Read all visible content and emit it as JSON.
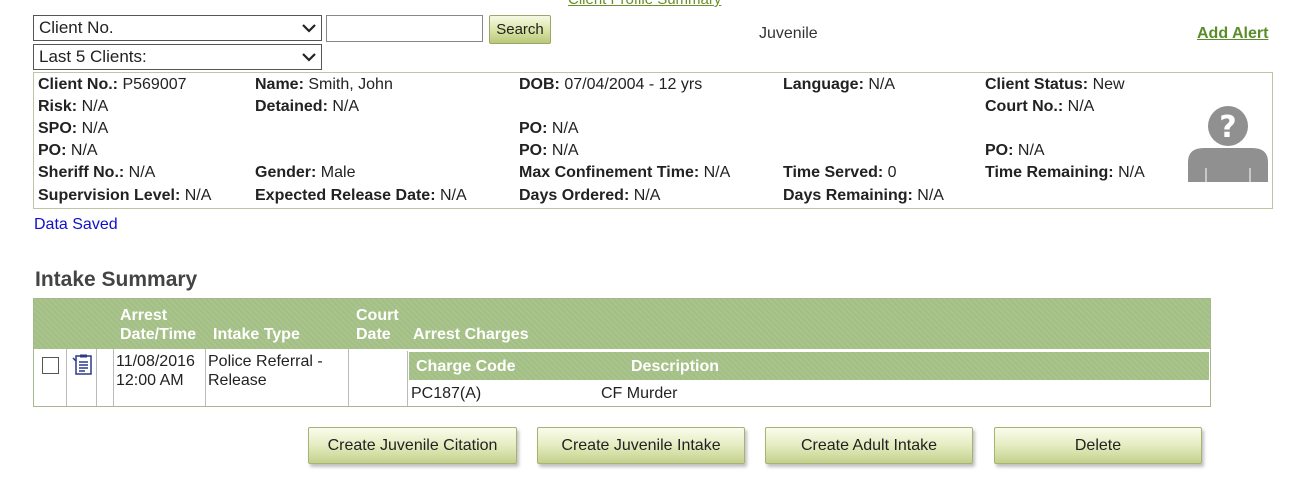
{
  "header": {
    "top_link": "Client Profile Summary",
    "client_select": "Client No.",
    "recent_select": "Last 5 Clients:",
    "search_value": "",
    "search_button": "Search",
    "client_type": "Juvenile",
    "add_alert": "Add Alert"
  },
  "client": {
    "client_no_label": "Client No.:",
    "client_no": "P569007",
    "name_label": "Name:",
    "name": "Smith, John",
    "dob_label": "DOB:",
    "dob": "07/04/2004 - 12 yrs",
    "language_label": "Language:",
    "language": "N/A",
    "status_label": "Client Status:",
    "status": "New",
    "risk_label": "Risk:",
    "risk": "N/A",
    "detained_label": "Detained:",
    "detained": "N/A",
    "court_no_label": "Court No.:",
    "court_no": "N/A",
    "spo_label": "SPO:",
    "spo": "N/A",
    "po1_label": "PO:",
    "po1": "N/A",
    "po2_label": "PO:",
    "po2": "N/A",
    "po3_label": "PO:",
    "po3": "N/A",
    "po4_label": "PO:",
    "po4": "N/A",
    "sheriff_label": "Sheriff No.:",
    "sheriff": "N/A",
    "gender_label": "Gender:",
    "gender": "Male",
    "max_conf_label": "Max Confinement Time:",
    "max_conf": "N/A",
    "time_served_label": "Time Served:",
    "time_served": "0",
    "time_remaining_label": "Time Remaining:",
    "time_remaining": "N/A",
    "supervision_label": "Supervision Level:",
    "supervision": "N/A",
    "release_label": "Expected Release Date:",
    "release": "N/A",
    "days_ordered_label": "Days Ordered:",
    "days_ordered": "N/A",
    "days_remaining_label": "Days Remaining:",
    "days_remaining": "N/A"
  },
  "status_message": "Data Saved",
  "intake": {
    "title": "Intake Summary",
    "columns": {
      "arrest_line1": "Arrest",
      "arrest_line2": "Date/Time",
      "intake_type": "Intake Type",
      "court_line1": "Court",
      "court_line2": "Date",
      "arrest_charges": "Arrest Charges"
    },
    "row": {
      "date_line1": "11/08/2016",
      "date_line2": "12:00 AM",
      "type_line1": "Police Referral -",
      "type_line2": "Release",
      "court_date": "",
      "charges_header": {
        "code": "Charge Code",
        "description": "Description"
      },
      "charges": [
        {
          "code": "PC187(A)",
          "description": "CF Murder"
        }
      ]
    }
  },
  "actions": {
    "juvenile_citation": "Create Juvenile Citation",
    "juvenile_intake": "Create Juvenile Intake",
    "adult_intake": "Create Adult Intake",
    "delete": "Delete"
  },
  "colors": {
    "accent": "#5a8c2a",
    "header_green": "#a6c289",
    "link_blue": "#1010cc"
  }
}
